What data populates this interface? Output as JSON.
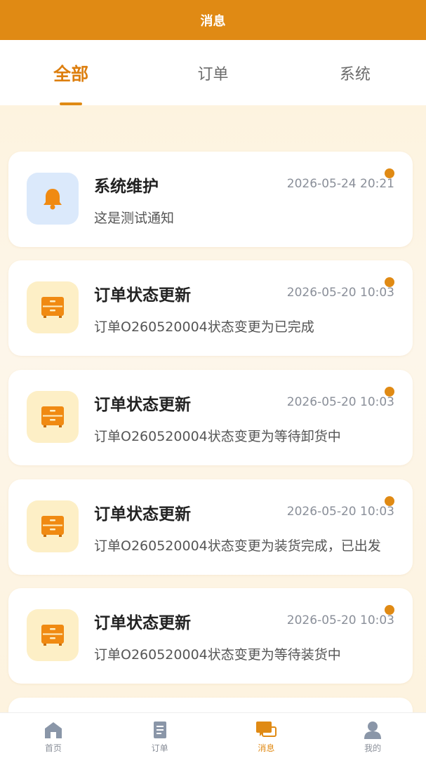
{
  "header": {
    "title": "消息"
  },
  "tabs": [
    {
      "label": "全部",
      "active": true
    },
    {
      "label": "订单",
      "active": false
    },
    {
      "label": "系统",
      "active": false
    }
  ],
  "messages": [
    {
      "icon": "bell-icon",
      "title": "系统维护",
      "time": "2026-05-24 20:21",
      "body": "这是测试通知",
      "unread": true
    },
    {
      "icon": "drawer-icon",
      "title": "订单状态更新",
      "time": "2026-05-20 10:03",
      "body": "订单O260520004状态变更为已完成",
      "unread": true
    },
    {
      "icon": "drawer-icon",
      "title": "订单状态更新",
      "time": "2026-05-20 10:03",
      "body": "订单O260520004状态变更为等待卸货中",
      "unread": true
    },
    {
      "icon": "drawer-icon",
      "title": "订单状态更新",
      "time": "2026-05-20 10:03",
      "body": "订单O260520004状态变更为装货完成，已出发",
      "unread": true
    },
    {
      "icon": "drawer-icon",
      "title": "订单状态更新",
      "time": "2026-05-20 10:03",
      "body": "订单O260520004状态变更为等待装货中",
      "unread": true
    }
  ],
  "bottom_nav": [
    {
      "label": "首页",
      "icon": "home-icon",
      "active": false
    },
    {
      "label": "订单",
      "icon": "document-icon",
      "active": false
    },
    {
      "label": "消息",
      "icon": "chat-icon",
      "active": true
    },
    {
      "label": "我的",
      "icon": "user-icon",
      "active": false
    }
  ],
  "colors": {
    "accent": "#e08a14",
    "background": "#fdf3df"
  }
}
